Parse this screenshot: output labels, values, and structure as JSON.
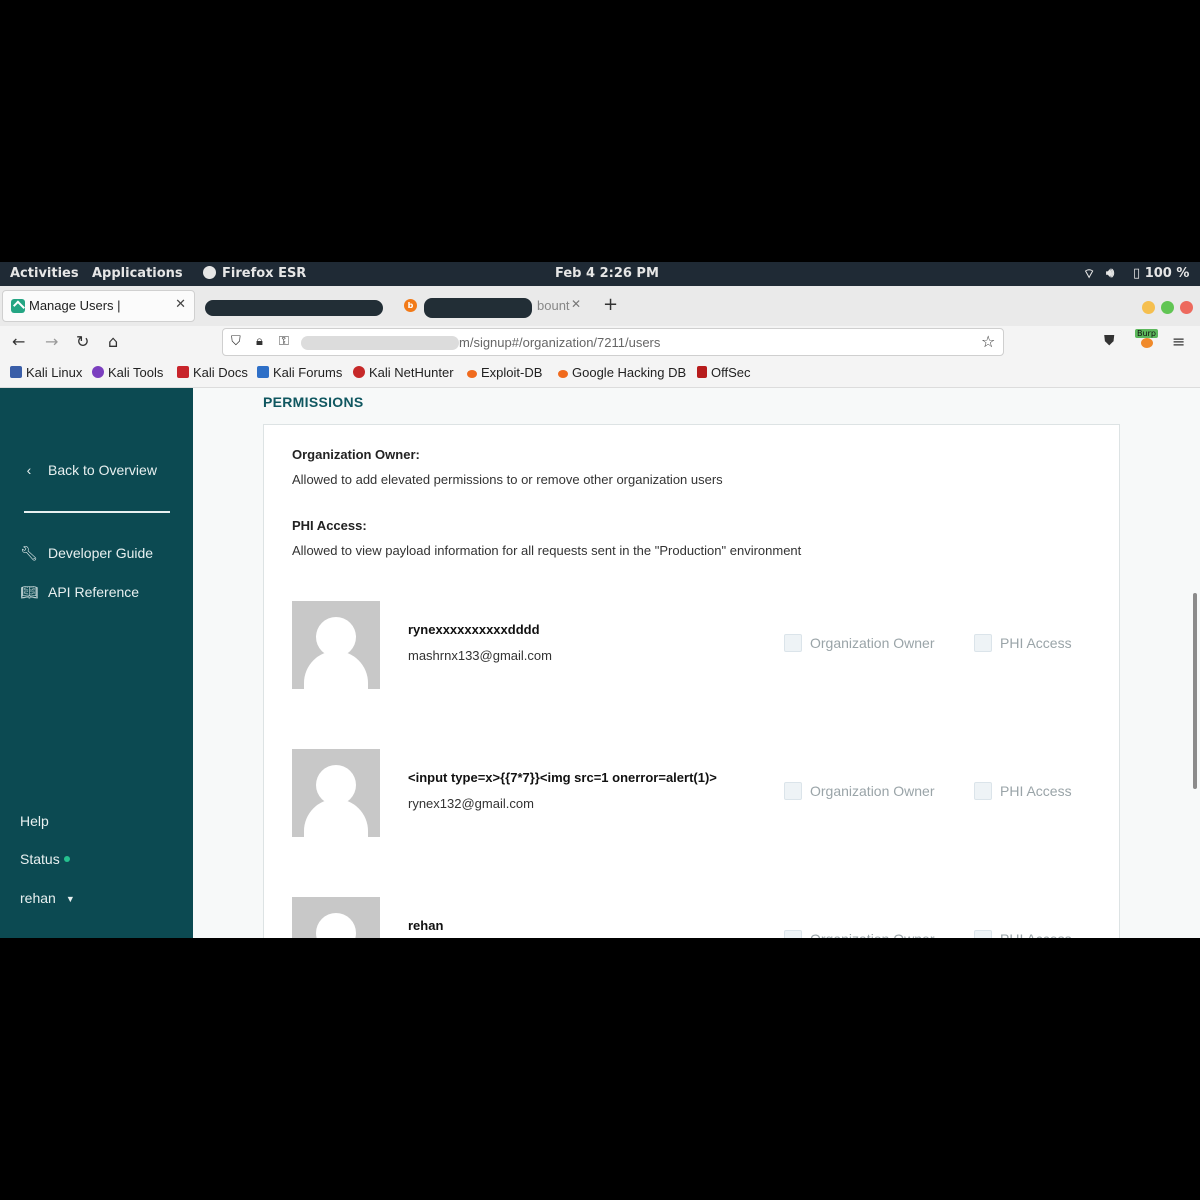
{
  "topbar": {
    "activities": "Activities",
    "applications": "Applications",
    "browser": "Firefox ESR",
    "clock": "Feb 4  2:26 PM",
    "battery": "100 %"
  },
  "tabs": {
    "active_title": "Manage Users |",
    "inactive_title": "bount"
  },
  "nav": {
    "url_visible": "m/signup#/organization/7211/users"
  },
  "bookmarks": [
    {
      "label": "Kali Linux"
    },
    {
      "label": "Kali Tools"
    },
    {
      "label": "Kali Docs"
    },
    {
      "label": "Kali Forums"
    },
    {
      "label": "Kali NetHunter"
    },
    {
      "label": "Exploit-DB"
    },
    {
      "label": "Google Hacking DB"
    },
    {
      "label": "OffSec"
    }
  ],
  "sidebar": {
    "back": "Back to Overview",
    "developer_guide": "Developer Guide",
    "api_reference": "API Reference",
    "help": "Help",
    "status": "Status",
    "user": "rehan"
  },
  "main": {
    "section_title": "PERMISSIONS",
    "perm_owner_title": "Organization Owner:",
    "perm_owner_desc": "Allowed to add elevated permissions to or remove other organization users",
    "perm_phi_title": "PHI Access:",
    "perm_phi_desc": "Allowed to view payload information for all requests sent in the \"Production\" environment",
    "checkbox_owner_label": "Organization Owner",
    "checkbox_phi_label": "PHI Access",
    "users": [
      {
        "name": "rynexxxxxxxxxxdddd",
        "email": "mashrnx133@gmail.com"
      },
      {
        "name": "<input type=x>{{7*7}}<img src=1 onerror=alert(1)>",
        "email": "rynex132@gmail.com"
      },
      {
        "name": "rehan",
        "email": ""
      }
    ]
  },
  "colors": {
    "sidebar_bg": "#0c4a52",
    "section_title": "#0f5760",
    "status_dot": "#25c18f"
  }
}
